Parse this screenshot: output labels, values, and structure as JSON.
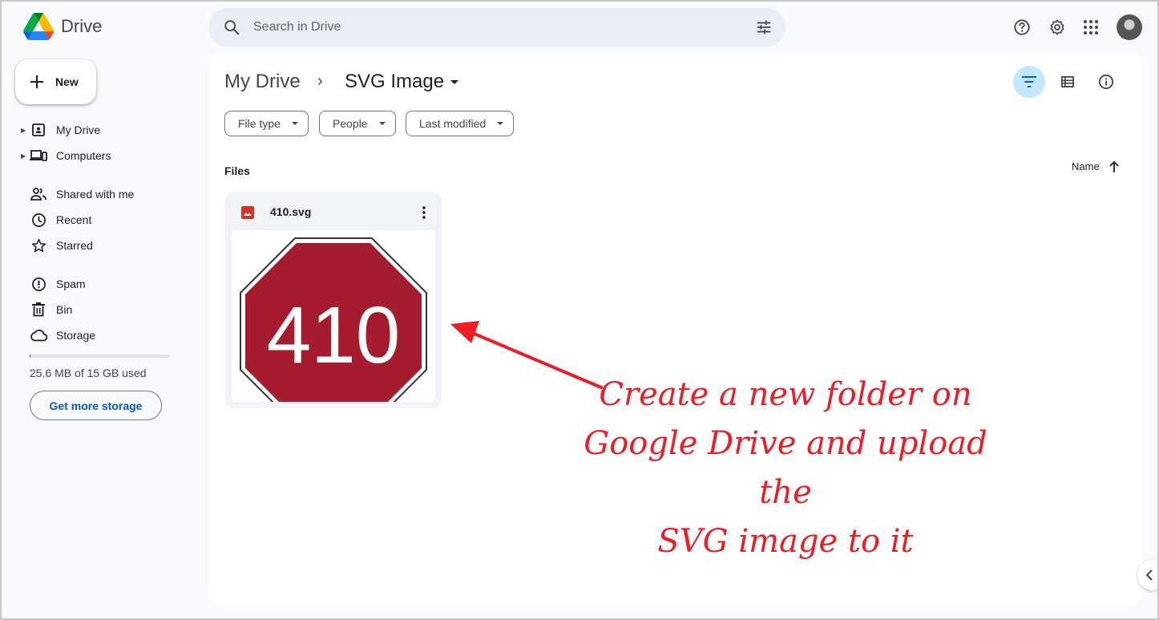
{
  "app": {
    "name": "Drive"
  },
  "search": {
    "placeholder": "Search in Drive"
  },
  "sidebar": {
    "new_label": "New",
    "items": [
      {
        "label": "My Drive"
      },
      {
        "label": "Computers"
      },
      {
        "label": "Shared with me"
      },
      {
        "label": "Recent"
      },
      {
        "label": "Starred"
      },
      {
        "label": "Spam"
      },
      {
        "label": "Bin"
      },
      {
        "label": "Storage"
      }
    ],
    "storage_used_text": "25.6 MB of 15 GB used",
    "storage_used_fraction": 0.0017,
    "get_storage_label": "Get more storage"
  },
  "main": {
    "breadcrumb_root": "My Drive",
    "breadcrumb_separator": "›",
    "breadcrumb_current": "SVG Image",
    "filters": [
      "File type",
      "People",
      "Last modified"
    ],
    "section_label": "Files",
    "sort_label": "Name",
    "files": [
      {
        "name": "410.svg",
        "thumbnail_text": "410"
      }
    ]
  },
  "annotation": {
    "lines": [
      "Create a new folder on",
      "Google Drive and upload the",
      "SVG image to it"
    ]
  },
  "colors": {
    "accent": "#0b57d0",
    "annotation": "#ee1c25",
    "stop_sign": "#a51c30",
    "search_bg": "#e9eef6"
  }
}
